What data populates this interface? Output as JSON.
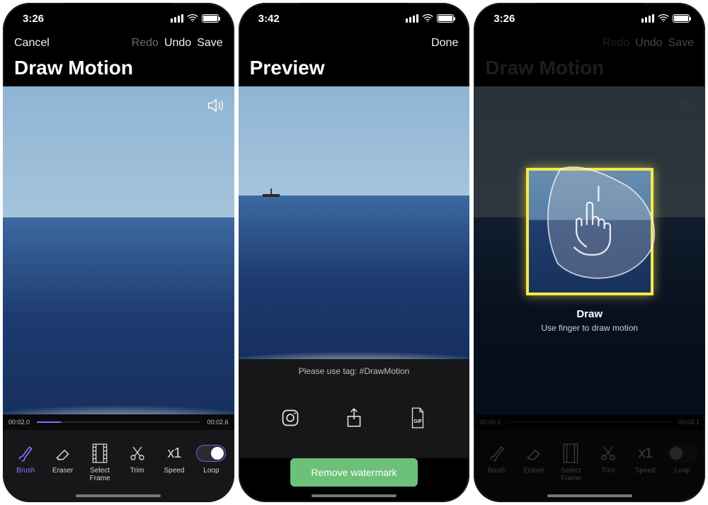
{
  "screens": {
    "draw": {
      "time": "3:26",
      "cancel": "Cancel",
      "redo": "Redo",
      "undo": "Undo",
      "save": "Save",
      "title": "Draw Motion",
      "t_start": "00:02.0",
      "t_end": "00:02.6",
      "tools": {
        "brush": "Brush",
        "eraser": "Eraser",
        "select_frame": "Select\nFrame",
        "trim": "Trim",
        "speed": "Speed",
        "loop": "Loop"
      },
      "speed_value": "x1"
    },
    "preview": {
      "time": "3:42",
      "done": "Done",
      "title": "Preview",
      "tagline": "Please use tag: #DrawMotion",
      "gif_badge": "GIF",
      "cta": "Remove watermark"
    },
    "tutorial": {
      "time": "3:26",
      "redo": "Redo",
      "undo": "Undo",
      "save": "Save",
      "title": "Draw Motion",
      "t_start": "00:00.5",
      "t_end": "00:04.1",
      "tut_title": "Draw",
      "tut_sub": "Use finger to draw motion",
      "tools": {
        "brush": "Brush",
        "eraser": "Eraser",
        "select_frame": "Select\nFrame",
        "trim": "Trim",
        "speed": "Speed",
        "loop": "Loop"
      },
      "speed_value": "x1"
    }
  }
}
